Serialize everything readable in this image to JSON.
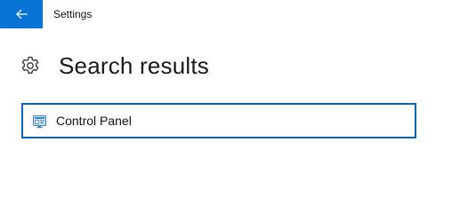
{
  "window": {
    "title": "Settings",
    "accent_color": "#0a74d6"
  },
  "icons": {
    "back": "arrow-left-icon",
    "page": "gear-icon",
    "result": "control-panel-icon"
  },
  "page": {
    "title": "Search results"
  },
  "results": [
    {
      "label": "Control Panel",
      "icon": "control-panel-icon",
      "focused": true
    }
  ]
}
